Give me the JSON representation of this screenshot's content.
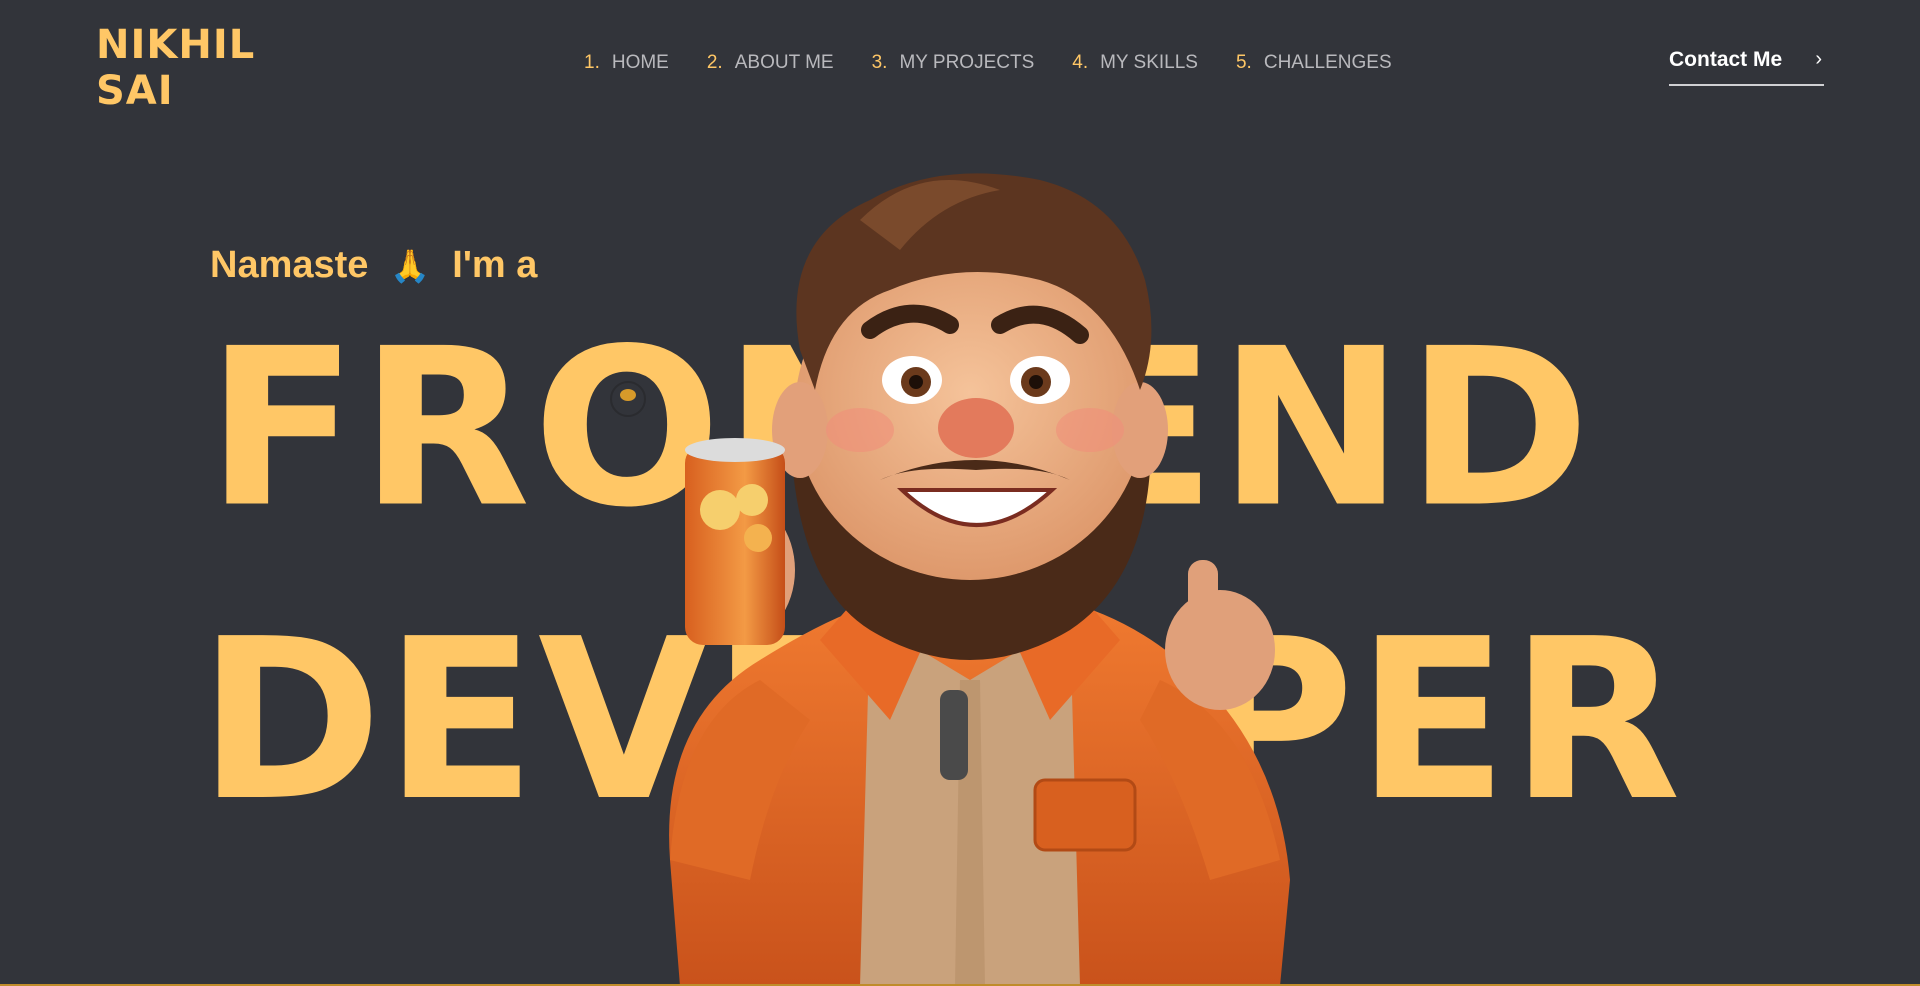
{
  "logo": {
    "line1": "NIKHIL",
    "line2": "SAI"
  },
  "nav": [
    {
      "num": "1.",
      "label": "HOME"
    },
    {
      "num": "2.",
      "label": "ABOUT ME"
    },
    {
      "num": "3.",
      "label": "MY PROJECTS"
    },
    {
      "num": "4.",
      "label": "MY SKILLS"
    },
    {
      "num": "5.",
      "label": "CHALLENGES"
    }
  ],
  "contact": {
    "label": "Contact Me",
    "icon": "chevron-right-icon"
  },
  "hero": {
    "greeting_start": "Namaste",
    "greeting_emoji": "🙏",
    "greeting_end": "I'm a",
    "line1": "FRONTEND",
    "line2": "DEVELOPER"
  },
  "colors": {
    "background": "#32343a",
    "accent": "#ffc766",
    "nav_text": "#b9b9bd",
    "jacket": "#e8702a"
  }
}
